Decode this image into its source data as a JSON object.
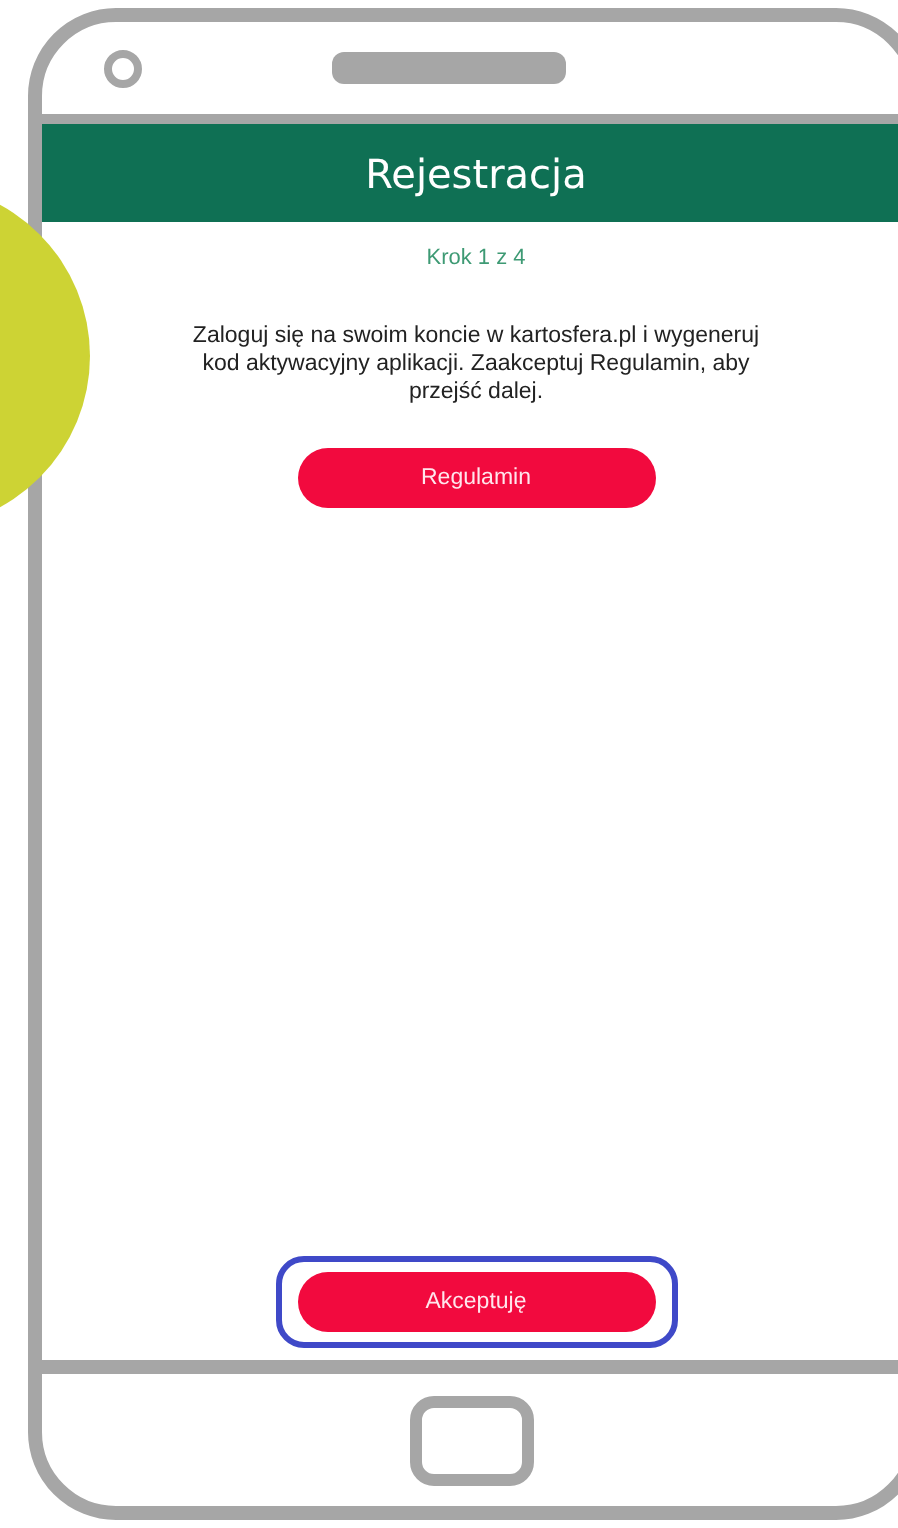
{
  "header": {
    "title": "Rejestracja"
  },
  "step": "Krok 1 z 4",
  "instruction": "Zaloguj się na swoim koncie w kartosfera.pl i wygeneruj kod aktywacyjny aplikacji. Zaakceptuj Regulamin, aby przejść dalej.",
  "buttons": [
    {
      "label": "Regulamin",
      "highlighted": false
    },
    {
      "label": "Akceptuję",
      "highlighted": true
    }
  ]
}
